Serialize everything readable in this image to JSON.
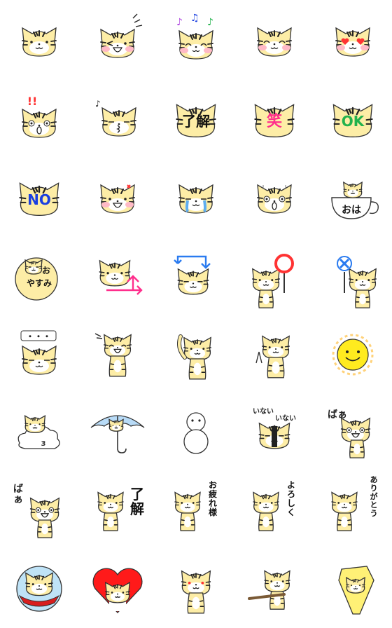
{
  "colors": {
    "fur": "#FDEDA6",
    "stripe": "#222222",
    "outline": "#333333",
    "blush": "#FFB9C6",
    "red": "#FF3333",
    "pink": "#FF2E8C",
    "green": "#22B24C",
    "blue": "#1A3FE0",
    "cyan_blue": "#2A7BF0",
    "tear": "#5FAEF0",
    "sun": "#FFEB1F",
    "sky": "#B8DBF7",
    "heart": "#FF1A1A",
    "circle_bg": "#BFE3F7"
  },
  "stamps": [
    {
      "name": "face-plain",
      "icon": "tiger-face"
    },
    {
      "name": "face-wink-laugh",
      "icon": "tiger-face"
    },
    {
      "name": "face-music",
      "icon": "tiger-face"
    },
    {
      "name": "face-blush-smile",
      "icon": "tiger-face"
    },
    {
      "name": "face-heart-eyes",
      "icon": "tiger-face"
    },
    {
      "name": "face-surprised",
      "icon": "tiger-face"
    },
    {
      "name": "face-kiss-whistle",
      "icon": "tiger-face"
    },
    {
      "name": "sign-ryokai",
      "icon": "tiger-sign",
      "text": "了解"
    },
    {
      "name": "sign-warai",
      "icon": "tiger-sign",
      "text": "笑"
    },
    {
      "name": "sign-ok",
      "icon": "tiger-sign",
      "text": "OK"
    },
    {
      "name": "sign-no",
      "icon": "tiger-sign",
      "text": "NO"
    },
    {
      "name": "face-angry",
      "icon": "tiger-face"
    },
    {
      "name": "face-crying",
      "icon": "tiger-face"
    },
    {
      "name": "face-shocked",
      "icon": "tiger-face"
    },
    {
      "name": "cup-ohayo",
      "icon": "cup",
      "text": "おは"
    },
    {
      "name": "moon-oyasumi",
      "icon": "moon",
      "text": "おやすみ",
      "text2": "お",
      "text3": "やすみ"
    },
    {
      "name": "face-arrow-pink",
      "icon": "arrow"
    },
    {
      "name": "face-arrow-blue",
      "icon": "arrow"
    },
    {
      "name": "holding-circle",
      "icon": "maru-sign"
    },
    {
      "name": "holding-cross",
      "icon": "batsu-sign"
    },
    {
      "name": "face-ellipsis",
      "icon": "speech-dots",
      "text": "・・・"
    },
    {
      "name": "body-laugh",
      "icon": "tiger-body"
    },
    {
      "name": "body-wave",
      "icon": "tiger-body"
    },
    {
      "name": "body-peace",
      "icon": "tiger-body"
    },
    {
      "name": "sun-smile",
      "icon": "sun"
    },
    {
      "name": "cloud-ride",
      "icon": "cloud"
    },
    {
      "name": "umbrella",
      "icon": "umbrella"
    },
    {
      "name": "snowman-eight",
      "icon": "outline"
    },
    {
      "name": "inai-inai",
      "icon": "tiger-body",
      "text": "いない",
      "text2": "いない"
    },
    {
      "name": "ba-peekaboo",
      "icon": "tiger-body",
      "text": "ばぁ"
    },
    {
      "name": "ba-jump",
      "icon": "tiger-body",
      "text": "ばぁ"
    },
    {
      "name": "body-ryokai",
      "icon": "tiger-body",
      "text": "了解"
    },
    {
      "name": "body-otsukaresama",
      "icon": "tiger-body",
      "text": "お疲れ様"
    },
    {
      "name": "body-yoroshiku",
      "icon": "tiger-body",
      "text": "よろしく"
    },
    {
      "name": "body-arigatou",
      "icon": "tiger-body",
      "text": "ありがとう"
    },
    {
      "name": "circle-cape",
      "icon": "circle"
    },
    {
      "name": "heart-frame",
      "icon": "heart"
    },
    {
      "name": "body-red-eyes",
      "icon": "tiger-body"
    },
    {
      "name": "body-bat",
      "icon": "tiger-body"
    },
    {
      "name": "spotlight",
      "icon": "light"
    }
  ]
}
